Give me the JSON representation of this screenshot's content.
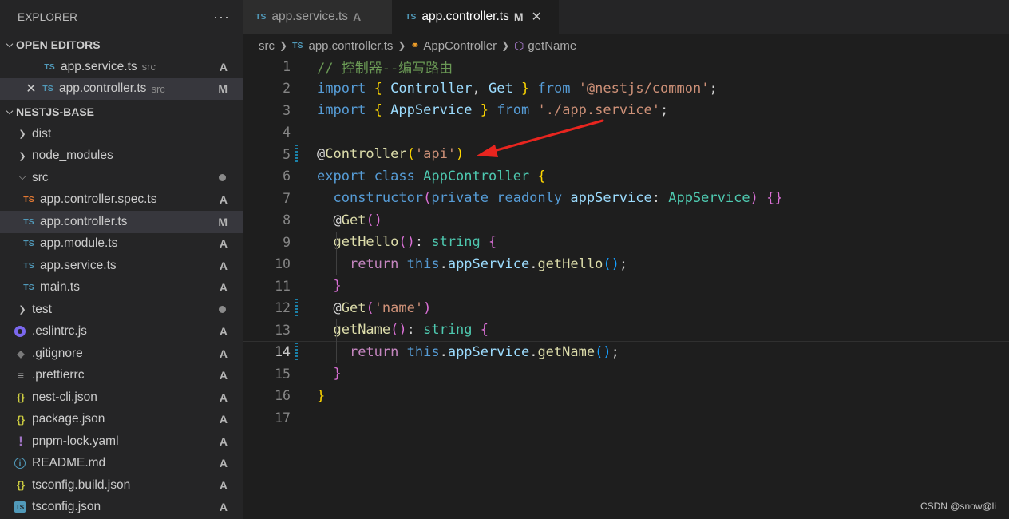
{
  "sidebar": {
    "title": "EXPLORER",
    "more": "···",
    "open_editors": {
      "label": "OPEN EDITORS",
      "items": [
        {
          "name": "app.service.ts",
          "desc": "src",
          "status": "A"
        },
        {
          "name": "app.controller.ts",
          "desc": "src",
          "status": "M"
        }
      ]
    },
    "project": {
      "label": "NESTJS-BASE",
      "items": [
        {
          "name": "dist"
        },
        {
          "name": "node_modules"
        },
        {
          "name": "src"
        },
        {
          "name": "app.controller.spec.ts",
          "status": "A"
        },
        {
          "name": "app.controller.ts",
          "status": "M"
        },
        {
          "name": "app.module.ts",
          "status": "A"
        },
        {
          "name": "app.service.ts",
          "status": "A"
        },
        {
          "name": "main.ts",
          "status": "A"
        },
        {
          "name": "test"
        },
        {
          "name": ".eslintrc.js",
          "status": "A"
        },
        {
          "name": ".gitignore",
          "status": "A"
        },
        {
          "name": ".prettierrc",
          "status": "A"
        },
        {
          "name": "nest-cli.json",
          "status": "A"
        },
        {
          "name": "package.json",
          "status": "A"
        },
        {
          "name": "pnpm-lock.yaml",
          "status": "A"
        },
        {
          "name": "README.md",
          "status": "A"
        },
        {
          "name": "tsconfig.build.json",
          "status": "A"
        },
        {
          "name": "tsconfig.json",
          "status": "A"
        }
      ]
    }
  },
  "tabs": [
    {
      "badge": "TS",
      "label": "app.service.ts",
      "status": "A"
    },
    {
      "badge": "TS",
      "label": "app.controller.ts",
      "status": "M",
      "close": "✕"
    }
  ],
  "breadcrumb": {
    "folder": "src",
    "file_badge": "TS",
    "file": "app.controller.ts",
    "class": "AppController",
    "method": "getName"
  },
  "editor": {
    "line_numbers": [
      "1",
      "2",
      "3",
      "4",
      "5",
      "6",
      "7",
      "8",
      "9",
      "10",
      "11",
      "12",
      "13",
      "14",
      "15",
      "16",
      "17"
    ],
    "active_line": "14",
    "lines": [
      {
        "t": [
          {
            "c": "c-com",
            "v": "// 控制器--编写路由"
          }
        ]
      },
      {
        "t": [
          {
            "c": "c-kw",
            "v": "import"
          },
          {
            "c": "c-t",
            "v": " "
          },
          {
            "c": "c-y",
            "v": "{"
          },
          {
            "c": "c-t",
            "v": " "
          },
          {
            "c": "c-var",
            "v": "Controller"
          },
          {
            "c": "c-t",
            "v": ", "
          },
          {
            "c": "c-var",
            "v": "Get"
          },
          {
            "c": "c-t",
            "v": " "
          },
          {
            "c": "c-y",
            "v": "}"
          },
          {
            "c": "c-t",
            "v": " "
          },
          {
            "c": "c-kw",
            "v": "from"
          },
          {
            "c": "c-t",
            "v": " "
          },
          {
            "c": "c-str",
            "v": "'@nestjs/common'"
          },
          {
            "c": "c-t",
            "v": ";"
          }
        ]
      },
      {
        "t": [
          {
            "c": "c-kw",
            "v": "import"
          },
          {
            "c": "c-t",
            "v": " "
          },
          {
            "c": "c-y",
            "v": "{"
          },
          {
            "c": "c-t",
            "v": " "
          },
          {
            "c": "c-var",
            "v": "AppService"
          },
          {
            "c": "c-t",
            "v": " "
          },
          {
            "c": "c-y",
            "v": "}"
          },
          {
            "c": "c-t",
            "v": " "
          },
          {
            "c": "c-kw",
            "v": "from"
          },
          {
            "c": "c-t",
            "v": " "
          },
          {
            "c": "c-str",
            "v": "'./app.service'"
          },
          {
            "c": "c-t",
            "v": ";"
          }
        ]
      },
      {
        "t": []
      },
      {
        "t": [
          {
            "c": "c-t",
            "v": "@"
          },
          {
            "c": "c-fn",
            "v": "Controller"
          },
          {
            "c": "c-y",
            "v": "("
          },
          {
            "c": "c-str",
            "v": "'api'"
          },
          {
            "c": "c-y",
            "v": ")"
          }
        ]
      },
      {
        "t": [
          {
            "c": "c-kw",
            "v": "export"
          },
          {
            "c": "c-t",
            "v": " "
          },
          {
            "c": "c-kw",
            "v": "class"
          },
          {
            "c": "c-t",
            "v": " "
          },
          {
            "c": "c-cls",
            "v": "AppController"
          },
          {
            "c": "c-t",
            "v": " "
          },
          {
            "c": "c-y",
            "v": "{"
          }
        ]
      },
      {
        "t": [
          {
            "c": "c-t",
            "v": "  "
          },
          {
            "c": "c-kw",
            "v": "constructor"
          },
          {
            "c": "c-p",
            "v": "("
          },
          {
            "c": "c-kw",
            "v": "private"
          },
          {
            "c": "c-t",
            "v": " "
          },
          {
            "c": "c-kw",
            "v": "readonly"
          },
          {
            "c": "c-t",
            "v": " "
          },
          {
            "c": "c-var",
            "v": "appService"
          },
          {
            "c": "c-t",
            "v": ": "
          },
          {
            "c": "c-cls",
            "v": "AppService"
          },
          {
            "c": "c-p",
            "v": ")"
          },
          {
            "c": "c-t",
            "v": " "
          },
          {
            "c": "c-p",
            "v": "{}"
          }
        ]
      },
      {
        "t": [
          {
            "c": "c-t",
            "v": "  @"
          },
          {
            "c": "c-fn",
            "v": "Get"
          },
          {
            "c": "c-p",
            "v": "()"
          }
        ]
      },
      {
        "t": [
          {
            "c": "c-t",
            "v": "  "
          },
          {
            "c": "c-fn",
            "v": "getHello"
          },
          {
            "c": "c-p",
            "v": "()"
          },
          {
            "c": "c-t",
            "v": ": "
          },
          {
            "c": "c-cls",
            "v": "string"
          },
          {
            "c": "c-t",
            "v": " "
          },
          {
            "c": "c-p",
            "v": "{"
          }
        ]
      },
      {
        "t": [
          {
            "c": "c-t",
            "v": "    "
          },
          {
            "c": "c-ctl",
            "v": "return"
          },
          {
            "c": "c-t",
            "v": " "
          },
          {
            "c": "c-kw",
            "v": "this"
          },
          {
            "c": "c-t",
            "v": "."
          },
          {
            "c": "c-var",
            "v": "appService"
          },
          {
            "c": "c-t",
            "v": "."
          },
          {
            "c": "c-fn",
            "v": "getHello"
          },
          {
            "c": "c-b",
            "v": "()"
          },
          {
            "c": "c-t",
            "v": ";"
          }
        ]
      },
      {
        "t": [
          {
            "c": "c-t",
            "v": "  "
          },
          {
            "c": "c-p",
            "v": "}"
          }
        ]
      },
      {
        "t": [
          {
            "c": "c-t",
            "v": "  @"
          },
          {
            "c": "c-fn",
            "v": "Get"
          },
          {
            "c": "c-p",
            "v": "("
          },
          {
            "c": "c-str",
            "v": "'name'"
          },
          {
            "c": "c-p",
            "v": ")"
          }
        ]
      },
      {
        "t": [
          {
            "c": "c-t",
            "v": "  "
          },
          {
            "c": "c-fn",
            "v": "getName"
          },
          {
            "c": "c-p",
            "v": "()"
          },
          {
            "c": "c-t",
            "v": ": "
          },
          {
            "c": "c-cls",
            "v": "string"
          },
          {
            "c": "c-t",
            "v": " "
          },
          {
            "c": "c-p",
            "v": "{"
          }
        ]
      },
      {
        "t": [
          {
            "c": "c-t",
            "v": "    "
          },
          {
            "c": "c-ctl",
            "v": "return"
          },
          {
            "c": "c-t",
            "v": " "
          },
          {
            "c": "c-kw",
            "v": "this"
          },
          {
            "c": "c-t",
            "v": "."
          },
          {
            "c": "c-var",
            "v": "appService"
          },
          {
            "c": "c-t",
            "v": "."
          },
          {
            "c": "c-fn",
            "v": "getName"
          },
          {
            "c": "c-b",
            "v": "()"
          },
          {
            "c": "c-t",
            "v": ";"
          }
        ]
      },
      {
        "t": [
          {
            "c": "c-t",
            "v": "  "
          },
          {
            "c": "c-p",
            "v": "}"
          }
        ]
      },
      {
        "t": [
          {
            "c": "c-y",
            "v": "}"
          }
        ]
      },
      {
        "t": []
      }
    ]
  },
  "annotation": {
    "arrow_color": "#e8251f"
  },
  "watermark": "CSDN @snow@li"
}
